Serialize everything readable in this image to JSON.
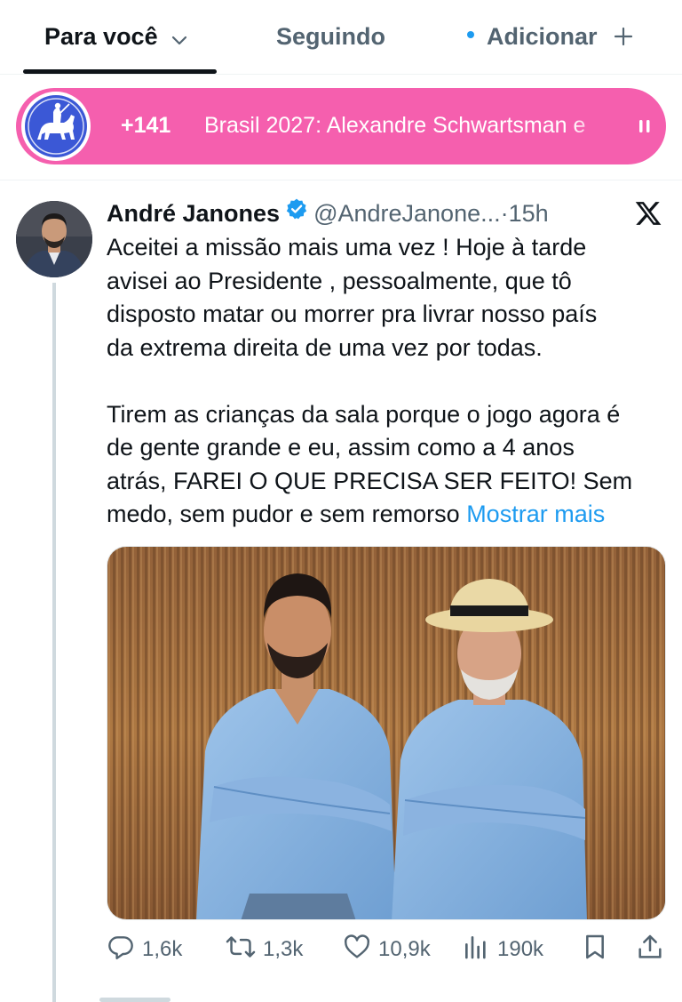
{
  "tabs": {
    "for_you": "Para você",
    "following": "Seguindo",
    "add": "Adicionar"
  },
  "banner": {
    "count": "+141",
    "text": "Brasil 2027: Alexandre Schwartsman e",
    "logo": "knight-on-horse-icon",
    "color": "#f55fae"
  },
  "tweet": {
    "name": "André Janones",
    "handle": "@AndreJanone...",
    "dot": "·",
    "time": "15h",
    "body_lines_1": [
      "Aceitei a missão mais uma vez ! Hoje à tarde",
      "avisei ao Presidente , pessoalmente, que tô",
      "disposto matar ou morrer pra livrar nosso país",
      "da extrema direita de uma vez por todas."
    ],
    "body_lines_2": [
      "Tirem as crianças da sala porque o jogo agora é",
      "de gente grande e eu, assim como a 4 anos",
      "atrás, FAREI O QUE PRECISA SER FEITO! Sem"
    ],
    "last_line": "medo, sem pudor e sem remorso",
    "show_more": "Mostrar mais",
    "replies": "1,6k",
    "reposts": "1,3k",
    "likes": "10,9k",
    "views": "190k"
  },
  "colors": {
    "accent": "#1d9bf0",
    "text": "#0f1419",
    "muted": "#536471",
    "banner": "#f55fae"
  }
}
